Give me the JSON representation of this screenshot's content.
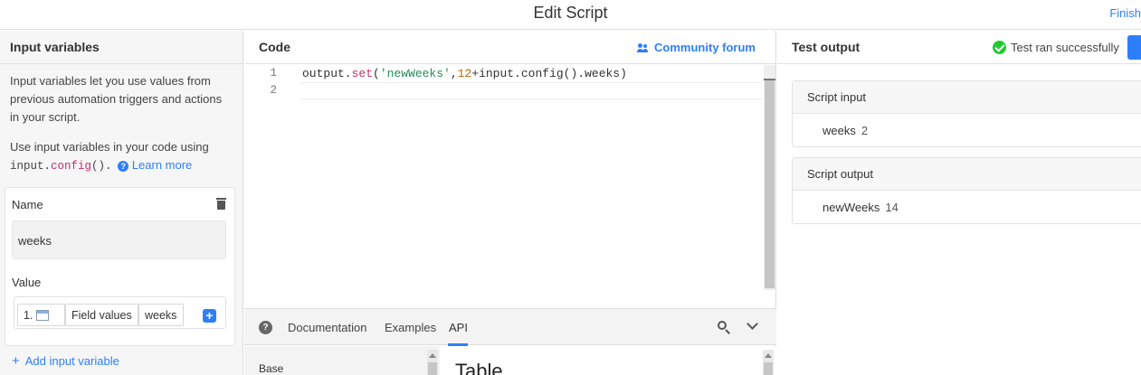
{
  "header": {
    "title": "Edit Script",
    "finish_label": "Finish"
  },
  "input_panel": {
    "title": "Input variables",
    "description": "Input variables let you use values from previous automation triggers and actions in your script.",
    "usage_text": "Use input variables in your code using",
    "code_obj": "input",
    "code_dot": ".",
    "code_fn": "config",
    "code_parens": "().",
    "help_glyph": "?",
    "learn_more": "Learn more",
    "variable": {
      "name_label": "Name",
      "name_value": "weeks",
      "value_label": "Value",
      "step_number": "1.",
      "source_label": "Field values",
      "field_label": "weeks",
      "plus_glyph": "+"
    },
    "add_variable_glyph": "+",
    "add_variable_label": "Add input variable"
  },
  "code_panel": {
    "title": "Code",
    "community_label": "Community forum",
    "lines": [
      {
        "number": "1"
      },
      {
        "number": "2"
      }
    ],
    "code": {
      "obj": "output.",
      "method": "set",
      "open": "(",
      "str": "'newWeeks'",
      "comma": ",",
      "num": "12",
      "rest": "+input.config().weeks)"
    }
  },
  "doc_panel": {
    "help_glyph": "?",
    "tabs": [
      {
        "label": "Documentation"
      },
      {
        "label": "Examples"
      },
      {
        "label": "API",
        "active": true
      }
    ],
    "sidebar_item": "Base",
    "heading": "Table"
  },
  "output_panel": {
    "title": "Test output",
    "status": "Test ran successfully",
    "script_input": {
      "title": "Script input",
      "key": "weeks",
      "value": "2"
    },
    "script_output": {
      "title": "Script output",
      "key": "newWeeks",
      "value": "14"
    }
  },
  "colors": {
    "accent": "#2d7ff9",
    "success": "#20c933"
  }
}
